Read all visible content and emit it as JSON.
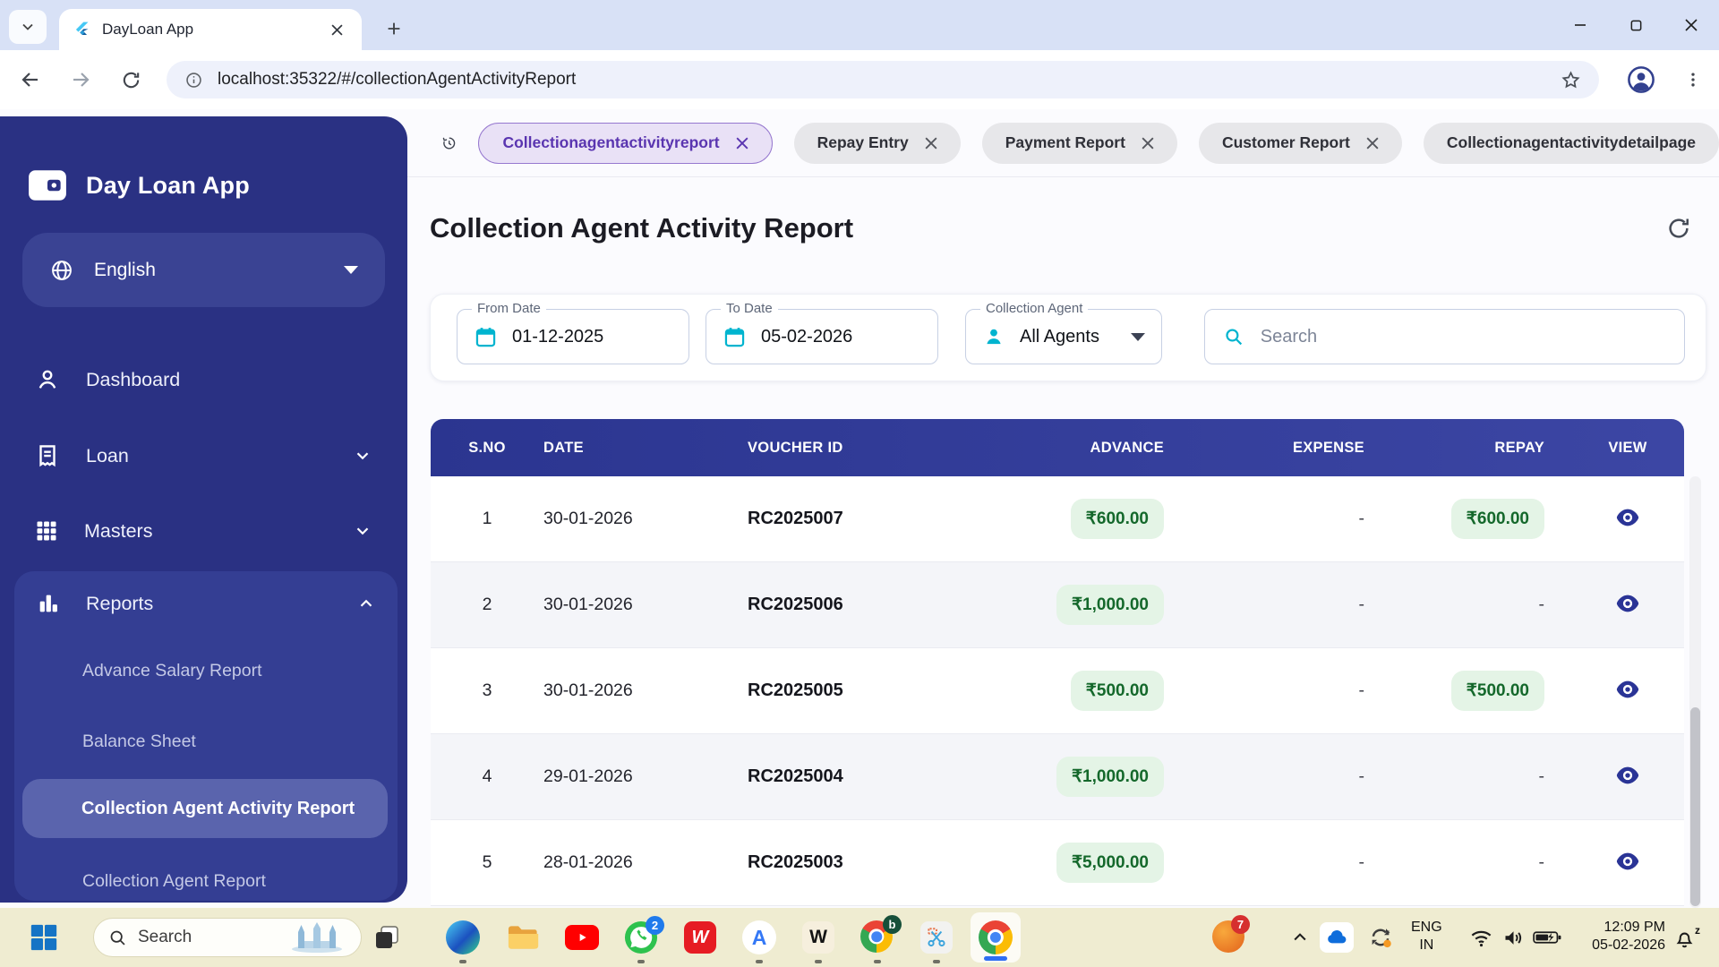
{
  "browser": {
    "tab_title": "DayLoan App",
    "url": "localhost:35322/#/collectionAgentActivityReport"
  },
  "sidebar": {
    "app_name": "Day Loan App",
    "language": "English",
    "items": [
      {
        "label": "Dashboard"
      },
      {
        "label": "Loan"
      },
      {
        "label": "Masters"
      },
      {
        "label": "Reports"
      }
    ],
    "report_items": [
      {
        "label": "Advance Salary Report"
      },
      {
        "label": "Balance Sheet"
      },
      {
        "label": "Collection Agent Activity Report"
      },
      {
        "label": "Collection Agent Report"
      }
    ]
  },
  "tabs_bar": {
    "chips": [
      {
        "label": "Collectionagentactivityreport"
      },
      {
        "label": "Repay Entry"
      },
      {
        "label": "Payment Report"
      },
      {
        "label": "Customer Report"
      },
      {
        "label": "Collectionagentactivitydetailpage"
      }
    ]
  },
  "page": {
    "title": "Collection Agent Activity Report"
  },
  "filters": {
    "from_date": {
      "label": "From Date",
      "value": "01-12-2025"
    },
    "to_date": {
      "label": "To Date",
      "value": "05-02-2026"
    },
    "agent": {
      "label": "Collection Agent",
      "value": "All Agents"
    },
    "search_placeholder": "Search"
  },
  "table": {
    "columns": [
      "S.NO",
      "DATE",
      "VOUCHER ID",
      "ADVANCE",
      "EXPENSE",
      "REPAY",
      "VIEW"
    ],
    "rows": [
      {
        "sno": "1",
        "date": "30-01-2026",
        "voucher": "RC2025007",
        "advance": "₹600.00",
        "expense": "-",
        "repay": "₹600.00"
      },
      {
        "sno": "2",
        "date": "30-01-2026",
        "voucher": "RC2025006",
        "advance": "₹1,000.00",
        "expense": "-",
        "repay": "-"
      },
      {
        "sno": "3",
        "date": "30-01-2026",
        "voucher": "RC2025005",
        "advance": "₹500.00",
        "expense": "-",
        "repay": "₹500.00"
      },
      {
        "sno": "4",
        "date": "29-01-2026",
        "voucher": "RC2025004",
        "advance": "₹1,000.00",
        "expense": "-",
        "repay": "-"
      },
      {
        "sno": "5",
        "date": "28-01-2026",
        "voucher": "RC2025003",
        "advance": "₹5,000.00",
        "expense": "-",
        "repay": "-"
      }
    ]
  },
  "taskbar": {
    "search_placeholder": "Search",
    "whatsapp_badge": "2",
    "chrome_badge": "b",
    "tray_badge": "7",
    "lang_line1": "ENG",
    "lang_line2": "IN",
    "time": "12:09 PM",
    "date": "05-02-2026"
  },
  "colors": {
    "sidebar_navy": "#2a3183",
    "table_header_navy": "#2b3590",
    "accent_cyan": "#00b4cf",
    "chip_active_purple": "#5a35b0",
    "pill_green_bg": "#e4f4e6",
    "pill_green_text": "#14682b"
  }
}
